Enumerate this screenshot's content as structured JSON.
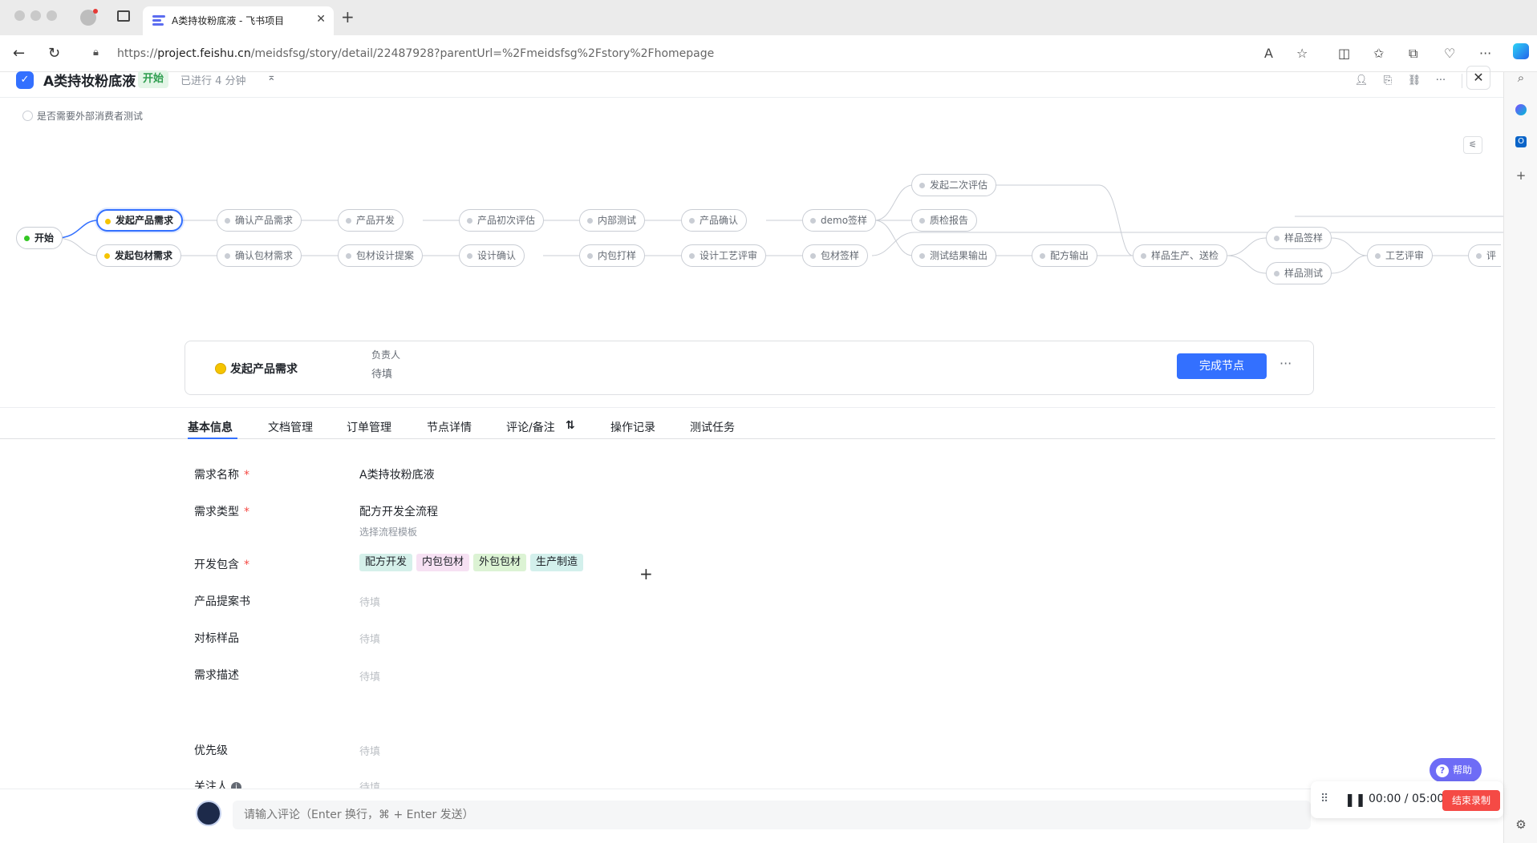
{
  "browser": {
    "tab_title": "A类持妆粉底液 - 飞书项目",
    "url_prefix": "https://",
    "url_domain": "project.feishu.cn",
    "url_path": "/meidsfsg/story/detail/22487928?parentUrl=%2Fmeidsfsg%2Fstory%2Fhomepage"
  },
  "header": {
    "title": "A类持妆粉底液",
    "status": "开始",
    "elapsed": "已进行 4 分钟"
  },
  "options": {
    "external_test": "是否需要外部消费者测试"
  },
  "workflow": {
    "nodes": [
      {
        "id": "start",
        "label": "开始",
        "state": "done"
      },
      {
        "id": "n1",
        "label": "发起产品需求",
        "state": "active"
      },
      {
        "id": "n2",
        "label": "发起包材需求",
        "state": "active"
      },
      {
        "id": "n3",
        "label": "确认产品需求",
        "state": "pending"
      },
      {
        "id": "n4",
        "label": "确认包材需求",
        "state": "pending"
      },
      {
        "id": "n5",
        "label": "产品开发",
        "state": "pending"
      },
      {
        "id": "n6",
        "label": "包材设计提案",
        "state": "pending"
      },
      {
        "id": "n7",
        "label": "产品初次评估",
        "state": "pending"
      },
      {
        "id": "n8",
        "label": "设计确认",
        "state": "pending"
      },
      {
        "id": "n9",
        "label": "内部测试",
        "state": "pending"
      },
      {
        "id": "n10",
        "label": "内包打样",
        "state": "pending"
      },
      {
        "id": "n11",
        "label": "产品确认",
        "state": "pending"
      },
      {
        "id": "n12",
        "label": "设计工艺评审",
        "state": "pending"
      },
      {
        "id": "n13",
        "label": "demo签样",
        "state": "pending"
      },
      {
        "id": "n14",
        "label": "包材签样",
        "state": "pending"
      },
      {
        "id": "n15",
        "label": "发起二次评估",
        "state": "pending"
      },
      {
        "id": "n16",
        "label": "质检报告",
        "state": "pending"
      },
      {
        "id": "n17",
        "label": "测试结果输出",
        "state": "pending"
      },
      {
        "id": "n18",
        "label": "配方输出",
        "state": "pending"
      },
      {
        "id": "n19",
        "label": "样品生产、送检",
        "state": "pending"
      },
      {
        "id": "n20",
        "label": "样品签样",
        "state": "pending"
      },
      {
        "id": "n21",
        "label": "样品测试",
        "state": "pending"
      },
      {
        "id": "n22",
        "label": "工艺评审",
        "state": "pending"
      },
      {
        "id": "n23",
        "label": "评",
        "state": "pending"
      }
    ]
  },
  "node_card": {
    "title": "发起产品需求",
    "owner_label": "负责人",
    "owner_value": "待填",
    "complete_button": "完成节点"
  },
  "tabs": [
    "基本信息",
    "文档管理",
    "订单管理",
    "节点详情",
    "评论/备注",
    "操作记录",
    "测试任务"
  ],
  "form": {
    "name_label": "需求名称",
    "name_value": "A类持妆粉底液",
    "type_label": "需求类型",
    "type_value": "配方开发全流程",
    "type_hint": "选择流程模板",
    "includes_label": "开发包含",
    "includes_tags": [
      {
        "text": "配方开发",
        "color": "#d5f0ea"
      },
      {
        "text": "内包包材",
        "color": "#f6e1f3"
      },
      {
        "text": "外包包材",
        "color": "#dcf3d4"
      },
      {
        "text": "生产制造",
        "color": "#d3f0ec"
      }
    ],
    "proposal_label": "产品提案书",
    "benchmark_label": "对标样品",
    "desc_label": "需求描述",
    "priority_label": "优先级",
    "followers_label": "关注人",
    "placeholder": "待填"
  },
  "comment": {
    "placeholder": "请输入评论（Enter 换行，⌘ + Enter 发送）"
  },
  "help": {
    "label": "帮助"
  },
  "recorder": {
    "time": "00:00 / 05:00",
    "stop_label": "结束录制"
  },
  "colors": {
    "accent": "#3370ff",
    "status_green": "#2e9e4f",
    "active_node": "#f5c400",
    "stop_red": "#f54a45"
  }
}
